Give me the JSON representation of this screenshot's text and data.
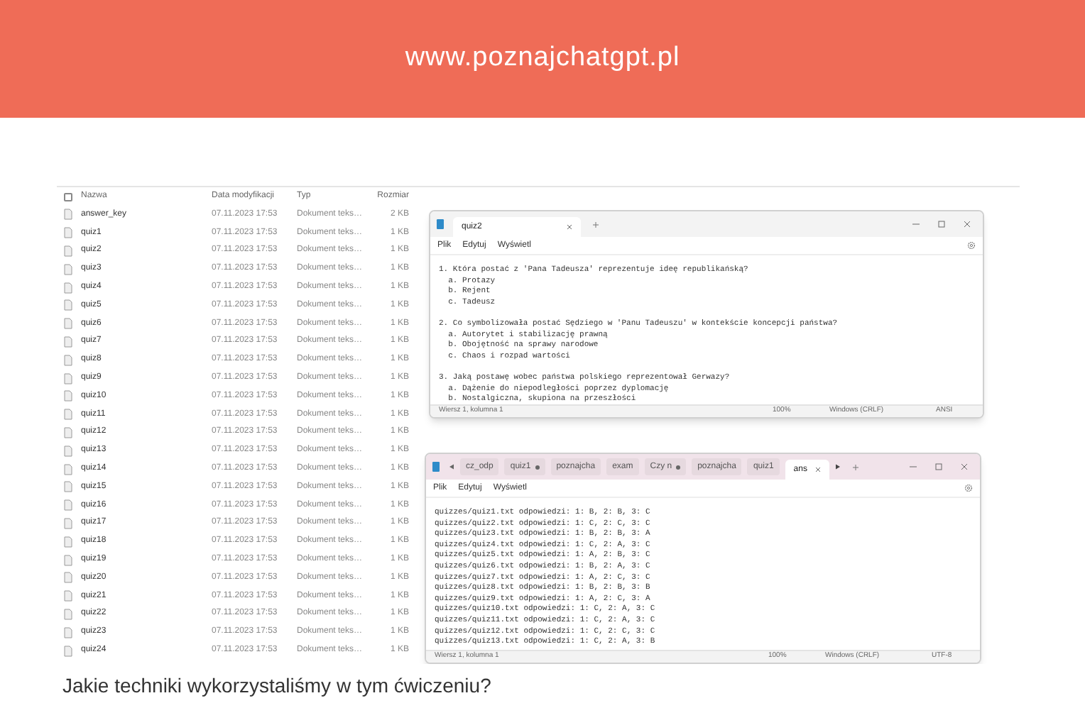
{
  "site_header": {
    "title": "www.poznajchatgpt.pl"
  },
  "explorer": {
    "select_all_checked": false,
    "columns": [
      "Nazwa",
      "Data modyfikacji",
      "Typ",
      "Rozmiar"
    ],
    "rows": [
      {
        "name": "answer_key",
        "date": "07.11.2023 17:53",
        "type": "Dokument teks…",
        "size": "2 KB"
      },
      {
        "name": "quiz1",
        "date": "07.11.2023 17:53",
        "type": "Dokument teks…",
        "size": "1 KB"
      },
      {
        "name": "quiz2",
        "date": "07.11.2023 17:53",
        "type": "Dokument teks…",
        "size": "1 KB"
      },
      {
        "name": "quiz3",
        "date": "07.11.2023 17:53",
        "type": "Dokument teks…",
        "size": "1 KB"
      },
      {
        "name": "quiz4",
        "date": "07.11.2023 17:53",
        "type": "Dokument teks…",
        "size": "1 KB"
      },
      {
        "name": "quiz5",
        "date": "07.11.2023 17:53",
        "type": "Dokument teks…",
        "size": "1 KB"
      },
      {
        "name": "quiz6",
        "date": "07.11.2023 17:53",
        "type": "Dokument teks…",
        "size": "1 KB"
      },
      {
        "name": "quiz7",
        "date": "07.11.2023 17:53",
        "type": "Dokument teks…",
        "size": "1 KB"
      },
      {
        "name": "quiz8",
        "date": "07.11.2023 17:53",
        "type": "Dokument teks…",
        "size": "1 KB"
      },
      {
        "name": "quiz9",
        "date": "07.11.2023 17:53",
        "type": "Dokument teks…",
        "size": "1 KB"
      },
      {
        "name": "quiz10",
        "date": "07.11.2023 17:53",
        "type": "Dokument teks…",
        "size": "1 KB"
      },
      {
        "name": "quiz11",
        "date": "07.11.2023 17:53",
        "type": "Dokument teks…",
        "size": "1 KB"
      },
      {
        "name": "quiz12",
        "date": "07.11.2023 17:53",
        "type": "Dokument teks…",
        "size": "1 KB"
      },
      {
        "name": "quiz13",
        "date": "07.11.2023 17:53",
        "type": "Dokument teks…",
        "size": "1 KB"
      },
      {
        "name": "quiz14",
        "date": "07.11.2023 17:53",
        "type": "Dokument teks…",
        "size": "1 KB"
      },
      {
        "name": "quiz15",
        "date": "07.11.2023 17:53",
        "type": "Dokument teks…",
        "size": "1 KB"
      },
      {
        "name": "quiz16",
        "date": "07.11.2023 17:53",
        "type": "Dokument teks…",
        "size": "1 KB"
      },
      {
        "name": "quiz17",
        "date": "07.11.2023 17:53",
        "type": "Dokument teks…",
        "size": "1 KB"
      },
      {
        "name": "quiz18",
        "date": "07.11.2023 17:53",
        "type": "Dokument teks…",
        "size": "1 KB"
      },
      {
        "name": "quiz19",
        "date": "07.11.2023 17:53",
        "type": "Dokument teks…",
        "size": "1 KB"
      },
      {
        "name": "quiz20",
        "date": "07.11.2023 17:53",
        "type": "Dokument teks…",
        "size": "1 KB"
      },
      {
        "name": "quiz21",
        "date": "07.11.2023 17:53",
        "type": "Dokument teks…",
        "size": "1 KB"
      },
      {
        "name": "quiz22",
        "date": "07.11.2023 17:53",
        "type": "Dokument teks…",
        "size": "1 KB"
      },
      {
        "name": "quiz23",
        "date": "07.11.2023 17:53",
        "type": "Dokument teks…",
        "size": "1 KB"
      },
      {
        "name": "quiz24",
        "date": "07.11.2023 17:53",
        "type": "Dokument teks…",
        "size": "1 KB"
      }
    ]
  },
  "windows": [
    {
      "tabs": [
        {
          "label": "quiz2",
          "selected": true,
          "modified": false
        }
      ],
      "menu": [
        "Plik",
        "Edytuj",
        "Wyświetl"
      ],
      "blocks": [
        [
          "1. Która postać z 'Pana Tadeusza' reprezentuje ideę republikańską?",
          "  a. Protazy",
          "  b. Rejent",
          "  c. Tadeusz"
        ],
        [
          "2. Co symbolizowała postać Sędziego w 'Panu Tadeuszu' w kontekście koncepcji państwa?",
          "  a. Autorytet i stabilizację prawną",
          "  b. Obojętność na sprawy narodowe",
          "  c. Chaos i rozpad wartości"
        ],
        [
          "3. Jaką postawę wobec państwa polskiego reprezentował Gerwazy?",
          "  a. Dążenie do niepodległości poprzez dyplomację",
          "  b. Nostalgiczna, skupiona na przeszłości"
        ]
      ],
      "status": [
        "Wiersz 1, kolumna 1",
        "100%",
        "Windows (CRLF)",
        "ANSI"
      ]
    },
    {
      "tabs": [
        {
          "label": "cz_odp",
          "selected": false,
          "modified": false
        },
        {
          "label": "quiz1",
          "selected": false,
          "modified": true
        },
        {
          "label": "poznajcha",
          "selected": false,
          "modified": false
        },
        {
          "label": "exam",
          "selected": false,
          "modified": false
        },
        {
          "label": "Czy n",
          "selected": false,
          "modified": true
        },
        {
          "label": "poznajcha",
          "selected": false,
          "modified": false
        },
        {
          "label": "quiz1",
          "selected": false,
          "modified": false
        },
        {
          "label": "ans",
          "selected": true,
          "modified": false
        }
      ],
      "menu": [
        "Plik",
        "Edytuj",
        "Wyświetl"
      ],
      "blocks": [
        [
          "quizzes/quiz1.txt odpowiedzi: 1: B, 2: B, 3: C",
          "quizzes/quiz2.txt odpowiedzi: 1: C, 2: C, 3: C",
          "quizzes/quiz3.txt odpowiedzi: 1: B, 2: B, 3: A",
          "quizzes/quiz4.txt odpowiedzi: 1: C, 2: A, 3: C",
          "quizzes/quiz5.txt odpowiedzi: 1: A, 2: B, 3: C",
          "quizzes/quiz6.txt odpowiedzi: 1: B, 2: A, 3: C",
          "quizzes/quiz7.txt odpowiedzi: 1: A, 2: C, 3: C",
          "quizzes/quiz8.txt odpowiedzi: 1: B, 2: B, 3: B",
          "quizzes/quiz9.txt odpowiedzi: 1: A, 2: C, 3: A",
          "quizzes/quiz10.txt odpowiedzi: 1: C, 2: A, 3: C",
          "quizzes/quiz11.txt odpowiedzi: 1: C, 2: A, 3: C",
          "quizzes/quiz12.txt odpowiedzi: 1: C, 2: C, 3: C",
          "quizzes/quiz13.txt odpowiedzi: 1: C, 2: A, 3: B"
        ]
      ],
      "status": [
        "Wiersz 1, kolumna 1",
        "100%",
        "Windows (CRLF)",
        "UTF-8"
      ]
    }
  ],
  "caption": "Jakie techniki wykorzystaliśmy w tym ćwiczeniu?"
}
